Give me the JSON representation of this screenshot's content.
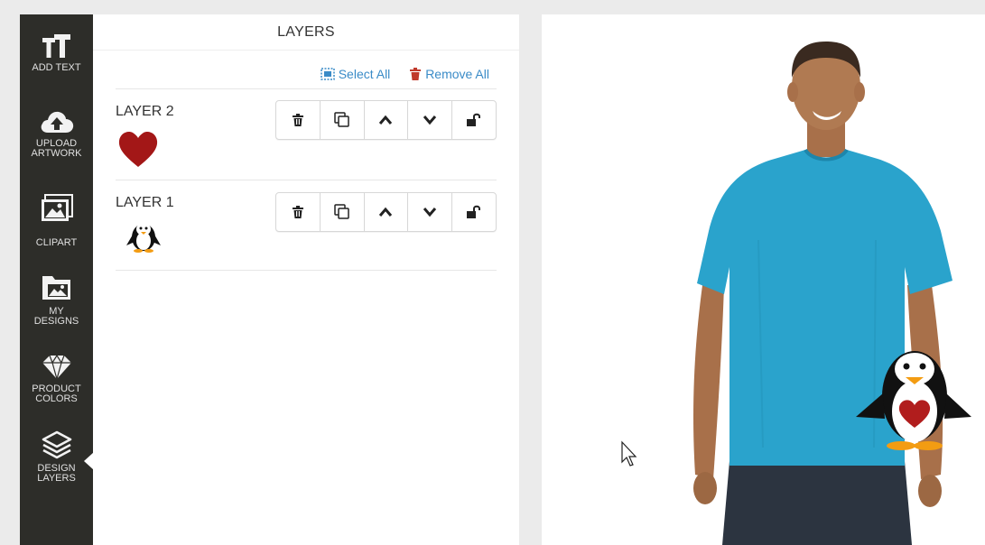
{
  "sidebar": {
    "items": [
      {
        "label": "ADD TEXT",
        "icon": "text-size-icon"
      },
      {
        "label": "UPLOAD\nARTWORK",
        "icon": "cloud-upload-icon"
      },
      {
        "label": "CLIPART",
        "icon": "image-icon"
      },
      {
        "label": "MY\nDESIGNS",
        "icon": "folder-image-icon"
      },
      {
        "label": "PRODUCT\nCOLORS",
        "icon": "diamond-icon"
      },
      {
        "label": "DESIGN\nLAYERS",
        "icon": "layers-icon",
        "active": true
      }
    ],
    "background": "#2d2d29"
  },
  "layers_panel": {
    "title": "LAYERS",
    "select_all": "Select All",
    "remove_all": "Remove All",
    "layers": [
      {
        "name": "LAYER 2",
        "thumbnail": "heart",
        "lock": "unlocked"
      },
      {
        "name": "LAYER 1",
        "thumbnail": "penguin",
        "lock": "unlocked"
      }
    ],
    "link_color": "#3a8bc7",
    "trash_color": "#c0392b"
  },
  "canvas": {
    "product": "t-shirt",
    "shirt_color": "#2aa3cc",
    "design_elements": [
      "penguin",
      "heart"
    ]
  }
}
